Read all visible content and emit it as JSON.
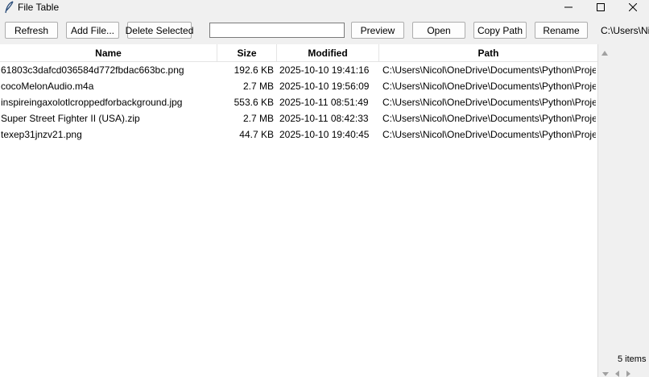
{
  "window": {
    "title": "File Table",
    "icon": "feather-icon"
  },
  "toolbar": {
    "refresh": "Refresh",
    "add_file": "Add File...",
    "delete_selected": "Delete Selected",
    "search_value": "",
    "preview": "Preview",
    "open": "Open",
    "copy_path": "Copy Path",
    "rename": "Rename",
    "current_path": "C:\\Users\\Ni"
  },
  "table": {
    "columns": [
      "Name",
      "Size",
      "Modified",
      "Path"
    ],
    "rows": [
      {
        "name": "61803c3dafcd036584d772fbdac663bc.png",
        "size": "192.6 KB",
        "modified": "2025-10-10 19:41:16",
        "path": "C:\\Users\\Nicol\\OneDrive\\Documents\\Python\\Proje"
      },
      {
        "name": "cocoMelonAudio.m4a",
        "size": "2.7 MB",
        "modified": "2025-10-10 19:56:09",
        "path": "C:\\Users\\Nicol\\OneDrive\\Documents\\Python\\Proje"
      },
      {
        "name": "inspireingaxolotlcroppedforbackground.jpg",
        "size": "553.6 KB",
        "modified": "2025-10-11 08:51:49",
        "path": "C:\\Users\\Nicol\\OneDrive\\Documents\\Python\\Proje"
      },
      {
        "name": "Super Street Fighter II (USA).zip",
        "size": "2.7 MB",
        "modified": "2025-10-11 08:42:33",
        "path": "C:\\Users\\Nicol\\OneDrive\\Documents\\Python\\Proje"
      },
      {
        "name": "texep31jnzv21.png",
        "size": "44.7 KB",
        "modified": "2025-10-10 19:40:45",
        "path": "C:\\Users\\Nicol\\OneDrive\\Documents\\Python\\Proje"
      }
    ]
  },
  "status": {
    "count": "5 items"
  }
}
